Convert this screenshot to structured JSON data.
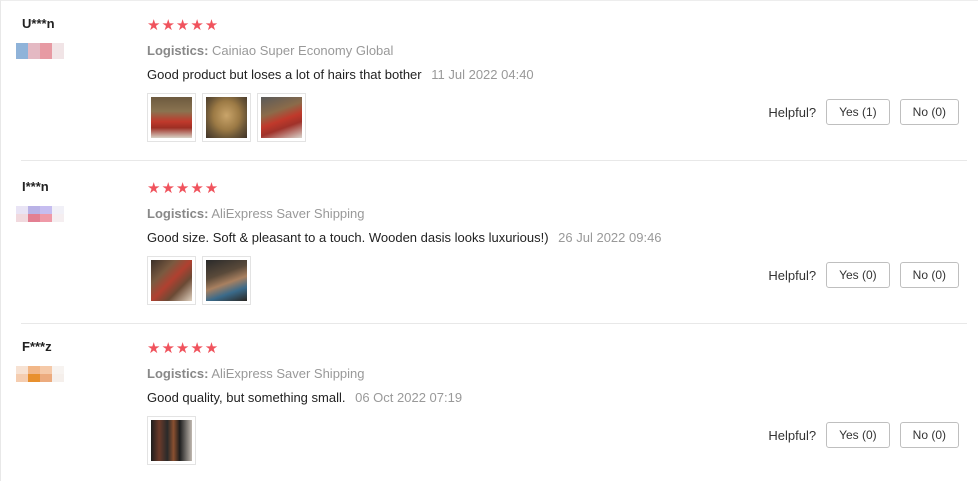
{
  "reviews": [
    {
      "user": "U***n",
      "stars": "★★★★★",
      "logistics_label": "Logistics:",
      "logistics": "Cainiao Super Economy Global",
      "text": "Good product but loses a lot of hairs that bother",
      "date": "11 Jul 2022 04:40",
      "helpful_label": "Helpful?",
      "yes": "Yes (1)",
      "no": "No (0)"
    },
    {
      "user": "I***n",
      "stars": "★★★★★",
      "logistics_label": "Logistics:",
      "logistics": "AliExpress Saver Shipping",
      "text": "Good size. Soft & pleasant to a touch. Wooden dasis looks luxurious!)",
      "date": "26 Jul 2022 09:46",
      "helpful_label": "Helpful?",
      "yes": "Yes (0)",
      "no": "No (0)"
    },
    {
      "user": "F***z",
      "stars": "★★★★★",
      "logistics_label": "Logistics:",
      "logistics": "AliExpress Saver Shipping",
      "text": "Good quality, but something small.",
      "date": "06 Oct 2022 07:19",
      "helpful_label": "Helpful?",
      "yes": "Yes (0)",
      "no": "No (0)"
    }
  ],
  "colors": {
    "star": "#f0535d",
    "muted": "#999999",
    "divider": "#e8e8e8"
  },
  "icons": {
    "rating": "star-icon",
    "country": "country-flag-icon",
    "photo": "review-photo"
  }
}
